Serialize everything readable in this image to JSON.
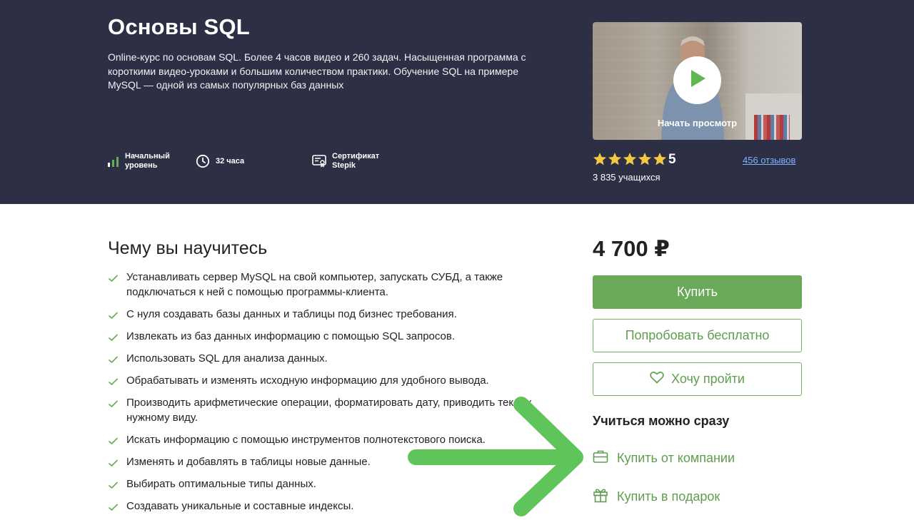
{
  "hero": {
    "title": "Основы SQL",
    "description": "Online-курс по основам SQL. Более 4 часов видео и 260 задач. Насыщенная программа с короткими видео-уроками и большим количеством практики. Обучение SQL на примере MySQL — одной из самых популярных баз данных",
    "meta": {
      "level_line1": "Начальный",
      "level_line2": "уровень",
      "hours": "32 часа",
      "cert_line1": "Сертификат",
      "cert_line2": "Stepik"
    },
    "video": {
      "caption": "Начать просмотр"
    },
    "rating": {
      "stars": 5,
      "value": "5",
      "learners": "3 835 учащихся",
      "reviews": "456 отзывов"
    }
  },
  "learn": {
    "title": "Чему вы научитесь",
    "items": [
      "Устанавливать сервер MySQL на свой компьютер, запускать СУБД, а также подключаться к ней с помощью программы-клиента.",
      "С нуля создавать базы данных и таблицы под бизнес требования.",
      "Извлекать из баз данных информацию с помощью SQL запросов.",
      "Использовать SQL для анализа данных.",
      "Обрабатывать и изменять исходную информацию для удобного вывода.",
      "Производить арифметические операции, форматировать дату, приводить текст к нужному виду.",
      "Искать информацию с помощью инструментов полнотекстового поиска.",
      "Изменять и добавлять в таблицы новые данные.",
      "Выбирать оптимальные типы данных.",
      "Создавать уникальные и составные индексы."
    ]
  },
  "purchase": {
    "price": "4 700 ₽",
    "buy_label": "Купить",
    "try_label": "Попробовать бесплатно",
    "wish_label": "Хочу пройти",
    "instant_title": "Учиться можно сразу",
    "company_label": "Купить от компании",
    "gift_label": "Купить в подарок"
  },
  "colors": {
    "hero_bg": "#2d3044",
    "accent_green": "#6aa85a",
    "arrow_green": "#5fc45a",
    "star_gold": "#f5c842",
    "link_blue": "#7fb0ff"
  },
  "icons": [
    "level-bars-icon",
    "clock-icon",
    "certificate-icon",
    "play-icon",
    "star-icon",
    "check-icon",
    "heart-icon",
    "briefcase-icon",
    "gift-icon"
  ]
}
